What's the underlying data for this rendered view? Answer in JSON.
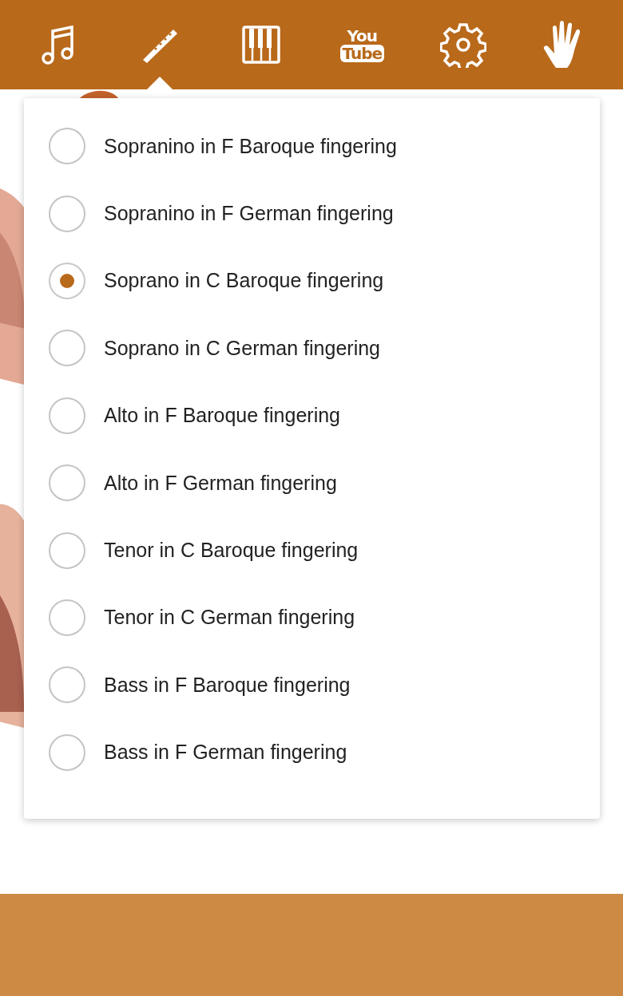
{
  "toolbar": {
    "tabs": [
      {
        "kind": "notes",
        "selected": false
      },
      {
        "kind": "recorder",
        "selected": true
      },
      {
        "kind": "piano",
        "selected": false
      },
      {
        "kind": "video",
        "selected": false,
        "text_lines": [
          "You",
          "Tube"
        ]
      },
      {
        "kind": "settings",
        "selected": false
      },
      {
        "kind": "hand",
        "selected": false
      }
    ]
  },
  "instrument_menu": {
    "options": [
      {
        "label": "Sopranino in F Baroque fingering",
        "selected": false
      },
      {
        "label": "Sopranino in F German fingering",
        "selected": false
      },
      {
        "label": "Soprano in C Baroque fingering",
        "selected": true
      },
      {
        "label": "Soprano in C German fingering",
        "selected": false
      },
      {
        "label": "Alto in F Baroque fingering",
        "selected": false
      },
      {
        "label": "Alto in F German fingering",
        "selected": false
      },
      {
        "label": "Tenor in C Baroque fingering",
        "selected": false
      },
      {
        "label": "Tenor in C German fingering",
        "selected": false
      },
      {
        "label": "Bass in F Baroque fingering",
        "selected": false
      },
      {
        "label": "Bass in F German fingering",
        "selected": false
      }
    ]
  }
}
